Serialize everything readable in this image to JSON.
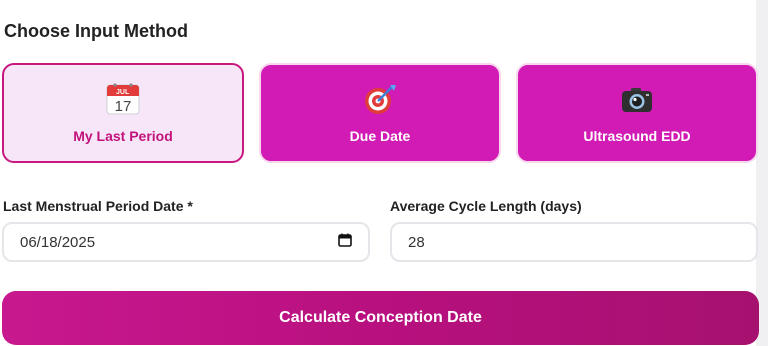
{
  "section_title": "Choose Input Method",
  "methods": [
    {
      "label": "My Last Period",
      "icon": "calendar-icon",
      "active": true
    },
    {
      "label": "Due Date",
      "icon": "target-icon",
      "active": false
    },
    {
      "label": "Ultrasound EDD",
      "icon": "camera-icon",
      "active": false
    }
  ],
  "calendar_icon_text": {
    "month": "JUL",
    "day": "17"
  },
  "fields": {
    "lmp_label": "Last Menstrual Period Date *",
    "lmp_value": "06/18/2025",
    "cycle_label": "Average Cycle Length (days)",
    "cycle_value": "28"
  },
  "submit_label": "Calculate Conception Date",
  "colors": {
    "accent": "#d21ab4",
    "accent_dark": "#a6116f",
    "active_bg": "#f6e6f8",
    "active_border": "#c8187f"
  }
}
